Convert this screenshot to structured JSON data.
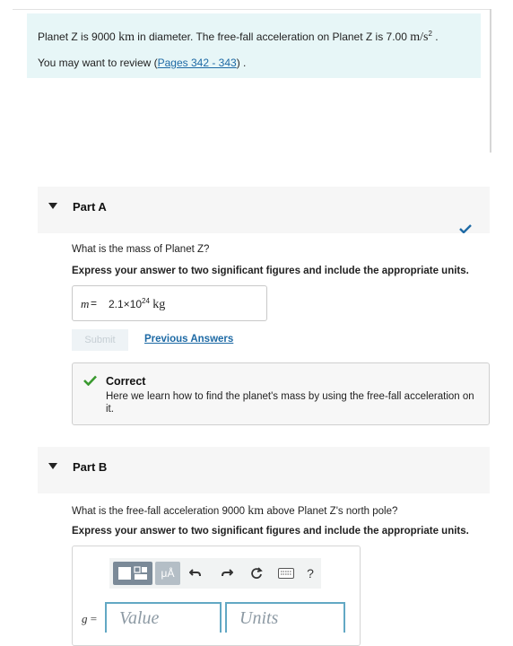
{
  "intro": {
    "line1_a": "Planet Z is 9000 ",
    "line1_unit1": "km",
    "line1_b": " in diameter. The free-fall acceleration on Planet Z is 7.00 ",
    "line1_unit2": "m/s",
    "line1_exp": "2",
    "line1_end": " .",
    "line2_a": "You may want to review (",
    "line2_link": "Pages 342 - 343",
    "line2_b": ") ."
  },
  "part_a": {
    "title": "Part A",
    "question": "What is the mass of Planet Z?",
    "instruction": "Express your answer to two significant figures and include the appropriate units.",
    "answer_var": "m",
    "answer_eq": " = ",
    "answer_mantissa": "2.1×10",
    "answer_exp": "24",
    "answer_unit": "kg",
    "submit_label": "Submit",
    "previous_answers_label": "Previous Answers",
    "feedback_title": "Correct",
    "feedback_text": "Here we learn how to find the planet's mass by using the free-fall acceleration on it.",
    "status": "correct"
  },
  "part_b": {
    "title": "Part B",
    "question_a": "What is the free-fall acceleration 9000 ",
    "question_unit": "km",
    "question_b": " above Planet Z's north pole?",
    "instruction": "Express your answer to two significant figures and include the appropriate units.",
    "toolbar": {
      "templates_icon": "templates-icon",
      "units_label": "μÅ",
      "undo_icon": "undo-icon",
      "redo_icon": "redo-icon",
      "reset_icon": "reset-icon",
      "keyboard_icon": "keyboard-icon",
      "help_label": "?"
    },
    "answer_var": "g",
    "answer_eq": " =",
    "value_placeholder": "Value",
    "units_placeholder": "Units"
  },
  "colors": {
    "intro_bg": "#e7f6f7",
    "link": "#1e6aa5",
    "check_green": "#3a9a2f",
    "check_blue": "#1e6aa5",
    "input_border": "#62a8c4"
  }
}
